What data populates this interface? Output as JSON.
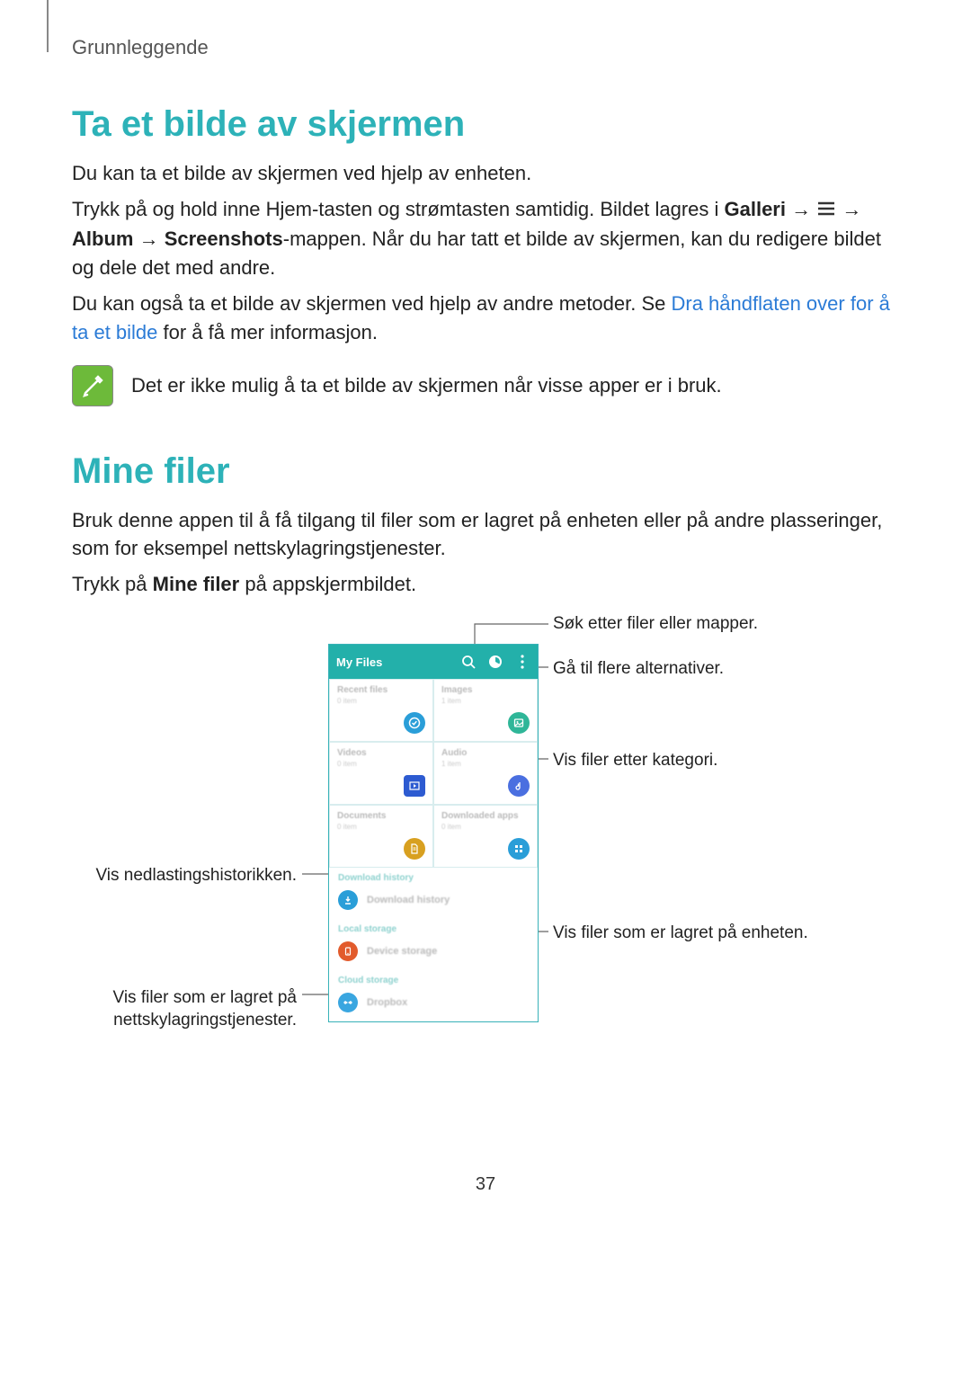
{
  "breadcrumb": "Grunnleggende",
  "section1": {
    "heading": "Ta et bilde av skjermen",
    "p1": "Du kan ta et bilde av skjermen ved hjelp av enheten.",
    "p2_a": "Trykk på og hold inne Hjem-tasten og strømtasten samtidig. Bildet lagres i ",
    "p2_b": "Galleri",
    "p2_c": " → ",
    "p2_d": " → ",
    "p2_e": "Album",
    "p2_f": " → ",
    "p2_g": "Screenshots",
    "p2_h": "-mappen. Når du har tatt et bilde av skjermen, kan du redigere bildet og dele det med andre.",
    "p3_a": "Du kan også ta et bilde av skjermen ved hjelp av andre metoder. Se ",
    "p3_link": "Dra håndflaten over for å ta et bilde",
    "p3_b": " for å få mer informasjon.",
    "note": "Det er ikke mulig å ta et bilde av skjermen når visse apper er i bruk."
  },
  "section2": {
    "heading": "Mine filer",
    "p1": "Bruk denne appen til å få tilgang til filer som er lagret på enheten eller på andre plasseringer, som for eksempel nettskylagringstjenester.",
    "p2_a": "Trykk på ",
    "p2_b": "Mine filer",
    "p2_c": " på appskjermbildet."
  },
  "callouts": {
    "search": "Søk etter filer eller mapper.",
    "more": "Gå til flere alternativer.",
    "category": "Vis filer etter kategori.",
    "download_history": "Vis nedlastingshistorikken.",
    "device": "Vis filer som er lagret på enheten.",
    "cloud": "Vis filer som er lagret på nettskylagringstjenester."
  },
  "phone": {
    "title": "My Files",
    "tiles": [
      {
        "label": "Recent files",
        "sub": "0 item",
        "color": "#2a9ed8",
        "icon": "check"
      },
      {
        "label": "Images",
        "sub": "1 item",
        "color": "#2fb698",
        "icon": "image"
      },
      {
        "label": "Videos",
        "sub": "0 item",
        "color": "#2d5bd1",
        "icon": "video"
      },
      {
        "label": "Audio",
        "sub": "1 item",
        "color": "#4a6fe0",
        "icon": "music"
      },
      {
        "label": "Documents",
        "sub": "0 item",
        "color": "#d8a020",
        "icon": "doc"
      },
      {
        "label": "Downloaded apps",
        "sub": "0 item",
        "color": "#2a9ed8",
        "icon": "apps"
      }
    ],
    "sec_dl": "Download history",
    "row_dl": "Download history",
    "sec_local": "Local storage",
    "row_local": "Device storage",
    "sec_cloud": "Cloud storage",
    "row_cloud": "Dropbox"
  },
  "page_number": "37"
}
